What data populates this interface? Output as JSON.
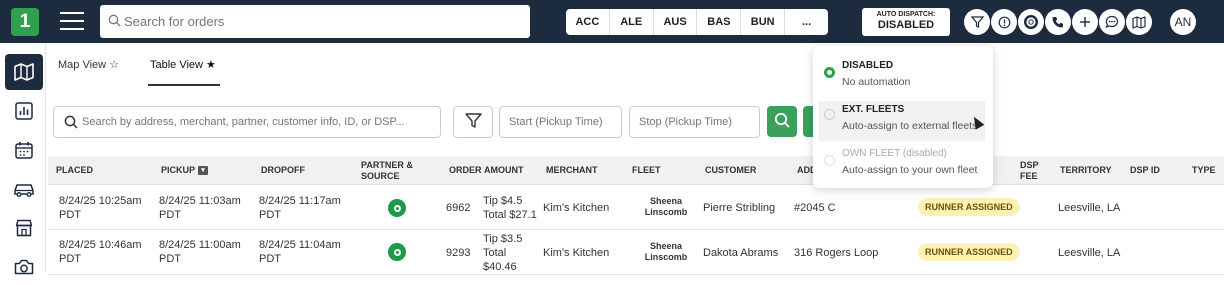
{
  "app": {
    "logo": "1"
  },
  "header": {
    "search_placeholder": "Search for orders",
    "territories": [
      "ACC",
      "ALE",
      "AUS",
      "BAS",
      "BUN",
      "..."
    ],
    "auto_dispatch": {
      "label": "AUTO DISPATCH:",
      "value": "DISABLED"
    },
    "icons": [
      "filter-icon",
      "info-icon",
      "support-icon",
      "phone-icon",
      "plus-icon",
      "chat-icon",
      "map-icon"
    ],
    "user_initials": "AN"
  },
  "sidebar": {
    "items": [
      "map-icon",
      "chart-icon",
      "calendar-icon",
      "car-icon",
      "store-icon",
      "camera-icon"
    ]
  },
  "view_tabs": [
    {
      "label": "Map View ☆"
    },
    {
      "label": "Table View ★"
    }
  ],
  "filters": {
    "search_placeholder": "Search by address, merchant, partner, customer info, ID, or DSP...",
    "start_placeholder": "Start (Pickup Time)",
    "stop_placeholder": "Stop (Pickup Time)"
  },
  "table": {
    "columns": [
      "PLACED",
      "PICKUP",
      "DROPOFF",
      "PARTNER & SOURCE",
      "ORDER",
      "AMOUNT",
      "MERCHANT",
      "FLEET",
      "CUSTOMER",
      "ADD",
      "DSP FEE",
      "TERRITORY",
      "DSP ID",
      "TYPE"
    ],
    "rows": [
      {
        "placed": "8/24/25 10:25am PDT",
        "pickup": "8/24/25 11:03am PDT",
        "dropoff": "8/24/25 11:17am PDT",
        "order": "6962",
        "amount1": "Tip $4.5",
        "amount2": "Total $27.1",
        "merchant": "Kim's Kitchen",
        "fleet": "Sheena Linscomb",
        "customer": "Pierre Stribling",
        "address": "#2045 C",
        "status": "RUNNER ASSIGNED",
        "territory": "Leesville, LA"
      },
      {
        "placed": "8/24/25 10:46am PDT",
        "pickup": "8/24/25 11:00am PDT",
        "dropoff": "8/24/25 11:04am PDT",
        "order": "9293",
        "amount1": "Tip $3.5",
        "amount2": "Total $40.46",
        "merchant": "Kim's Kitchen",
        "fleet": "Sheena Linscomb",
        "customer": "Dakota Abrams",
        "address": "316 Rogers Loop",
        "status": "RUNNER ASSIGNED",
        "territory": "Leesville, LA"
      }
    ]
  },
  "dropdown": {
    "options": [
      {
        "title": "DISABLED",
        "sub": "No automation",
        "selected": true
      },
      {
        "title": "EXT. FLEETS",
        "sub": "Auto-assign to external fleets",
        "selected": false
      },
      {
        "title": "OWN FLEET (disabled)",
        "sub": "Auto-assign to your own fleet",
        "selected": false
      }
    ]
  },
  "colors": {
    "header": "#1d2b3f",
    "brand": "#2fa04e",
    "badge": "#fdf1b5"
  }
}
